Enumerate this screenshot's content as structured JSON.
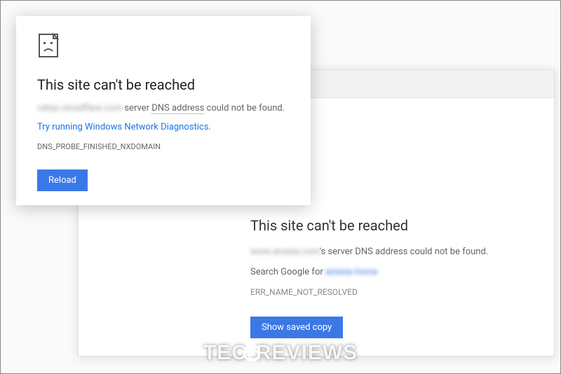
{
  "front": {
    "title": "This site can't be reached",
    "blurred_host": "cdnjs.cloudflare.com",
    "msg_before_dns": " server ",
    "dns_text": "DNS address",
    "msg_after_dns": " could not be found.",
    "diag_link": "Try running Windows Network Diagnostics.",
    "error_code": "DNS_PROBE_FINISHED_NXDOMAIN",
    "reload_label": "Reload"
  },
  "back": {
    "title": "This site can't be reached",
    "blurred_host": "www.airasia.com",
    "msg_tail": "'s server DNS address could not be found.",
    "search_prefix": "Search Google for ",
    "search_term": "airasia home",
    "error_code": "ERR_NAME_NOT_RESOLVED",
    "button_label": "Show saved copy"
  },
  "watermark": {
    "left": "TEC",
    "right": "REVIEWS"
  }
}
